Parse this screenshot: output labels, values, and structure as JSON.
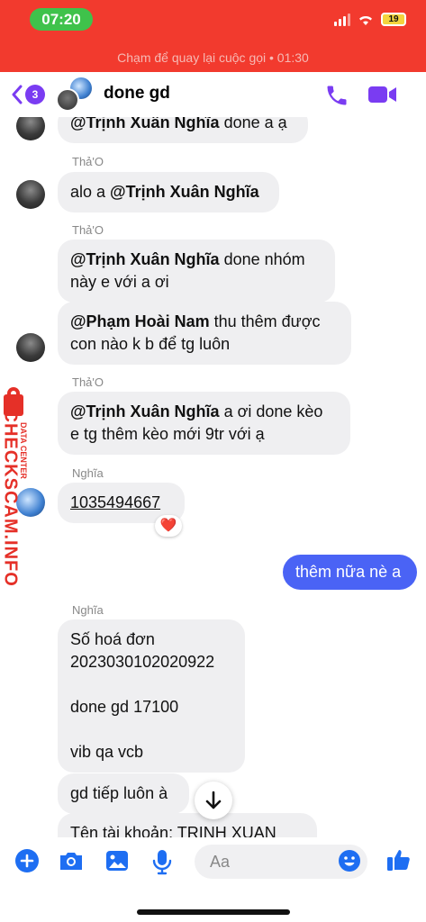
{
  "status": {
    "time": "07:20",
    "battery": "19",
    "call_banner": "Chạm để quay lại cuộc gọi • 01:30"
  },
  "header": {
    "back_badge": "3",
    "title": "done gd",
    "icons": [
      "chevron-left-icon",
      "phone-icon",
      "video-icon"
    ],
    "accent": "#7a3cf2"
  },
  "messages": {
    "m1": {
      "mention": "@Trịnh Xuân Nghĩa",
      "text": " done a ạ"
    },
    "s1": "Thả'O",
    "m2": {
      "lead": "alo a ",
      "mention": "@Trịnh Xuân Nghĩa"
    },
    "s2": "Thả'O",
    "m3": {
      "mention": "@Trịnh Xuân Nghĩa",
      "text1": " done nhóm",
      "text2": "này e với a ơi"
    },
    "m4": {
      "mention": "@Phạm Hoài Nam",
      "text1": " thu thêm được",
      "text2": "con nào k b để tg luôn"
    },
    "s3": "Thả'O",
    "m5": {
      "mention": "@Trịnh Xuân Nghĩa",
      "text1": " a ơi done kèo",
      "text2": "e tg thêm kèo mới 9tr với ạ"
    },
    "s4": "Nghĩa",
    "m6": {
      "text": "1035494667",
      "reaction": "❤️"
    },
    "out1": "thêm nữa nè a",
    "s5": "Nghĩa",
    "m7": {
      "l1": "Số hoá đơn",
      "l2": "2023030102020922",
      "l3": "done gd 17100",
      "l4": "vib qa vcb"
    },
    "m8": "gd tiếp luôn à",
    "m9": "Tên tài khoản: TRINH XUAN"
  },
  "watermark": {
    "brand": "CHECKSCAM.INFO",
    "sub": "DATA CENTER"
  },
  "composer": {
    "placeholder": "Aa",
    "icons": [
      "plus-icon",
      "camera-icon",
      "image-icon",
      "mic-icon",
      "emoji-icon",
      "like-icon"
    ],
    "accent": "#1e6ef2"
  }
}
